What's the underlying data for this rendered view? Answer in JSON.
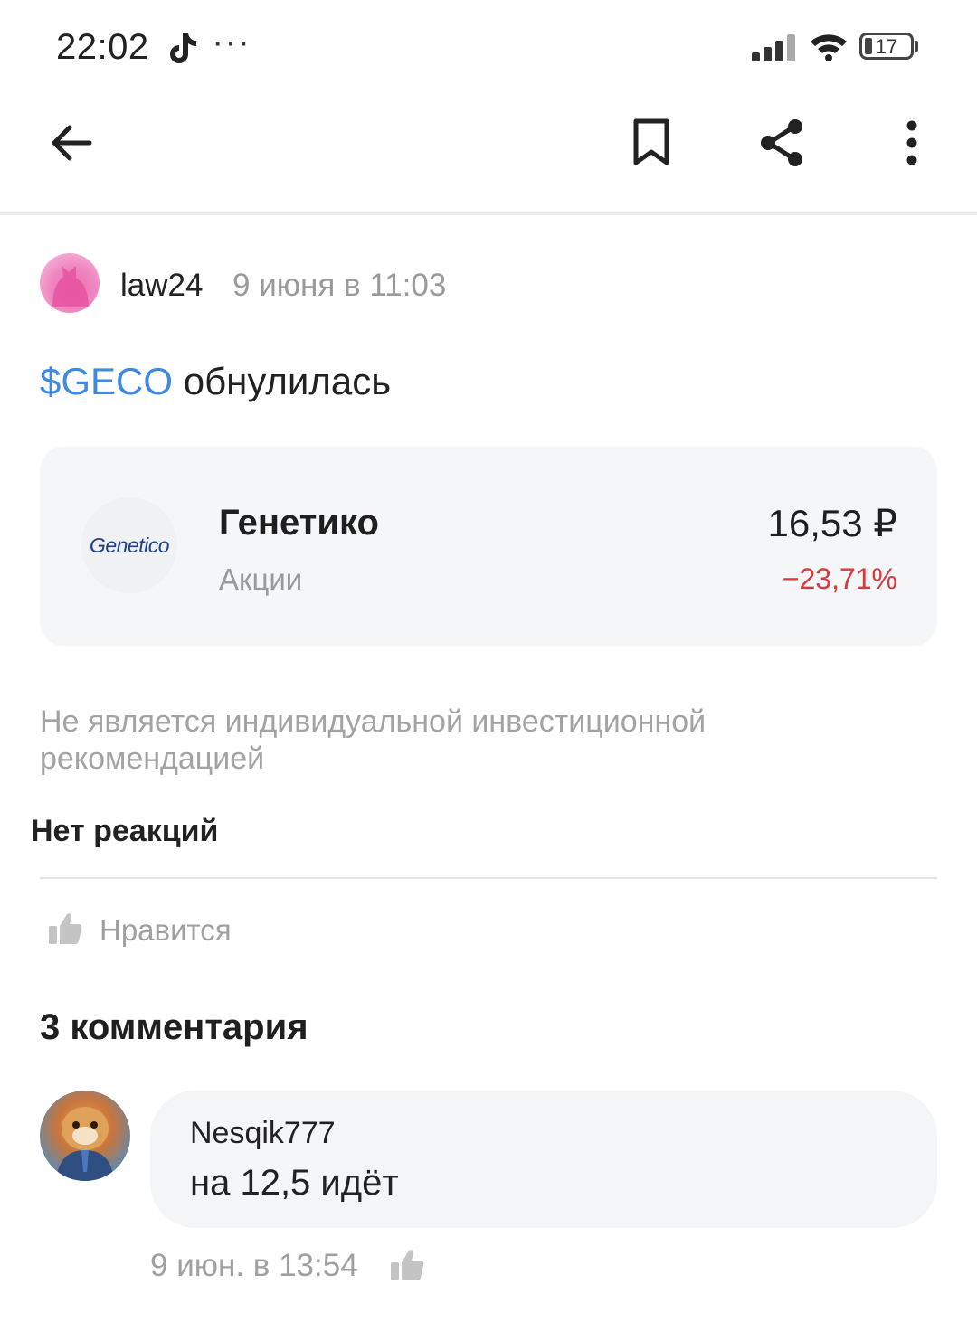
{
  "status_bar": {
    "time": "22:02",
    "battery": "17",
    "extra": "···"
  },
  "header": {
    "back_icon": "arrow-left-icon",
    "bookmark_icon": "bookmark-icon",
    "share_icon": "share-icon",
    "more_icon": "more-vertical-icon"
  },
  "post": {
    "author": "law24",
    "date": "9 июня в 11:03",
    "ticker": "$GECO",
    "text": " обнулилась",
    "stock": {
      "logo_text": "Genetico",
      "name": "Генетико",
      "type": "Акции",
      "price": "16,53 ₽",
      "change": "−23,71%",
      "change_color": "#d9383d"
    },
    "disclaimer": "Не является индивидуальной инвестиционной рекомендацией",
    "reactions_label": "Нет реакций",
    "like_label": "Нравится"
  },
  "comments": {
    "title": "3 комментария",
    "items": [
      {
        "author": "Nesqik777",
        "text": "на 12,5 идёт",
        "date": "9 июн. в 13:54"
      }
    ]
  },
  "colors": {
    "accent": "#3d8ae0",
    "negative": "#d9383d",
    "muted": "#9a9a9a"
  }
}
